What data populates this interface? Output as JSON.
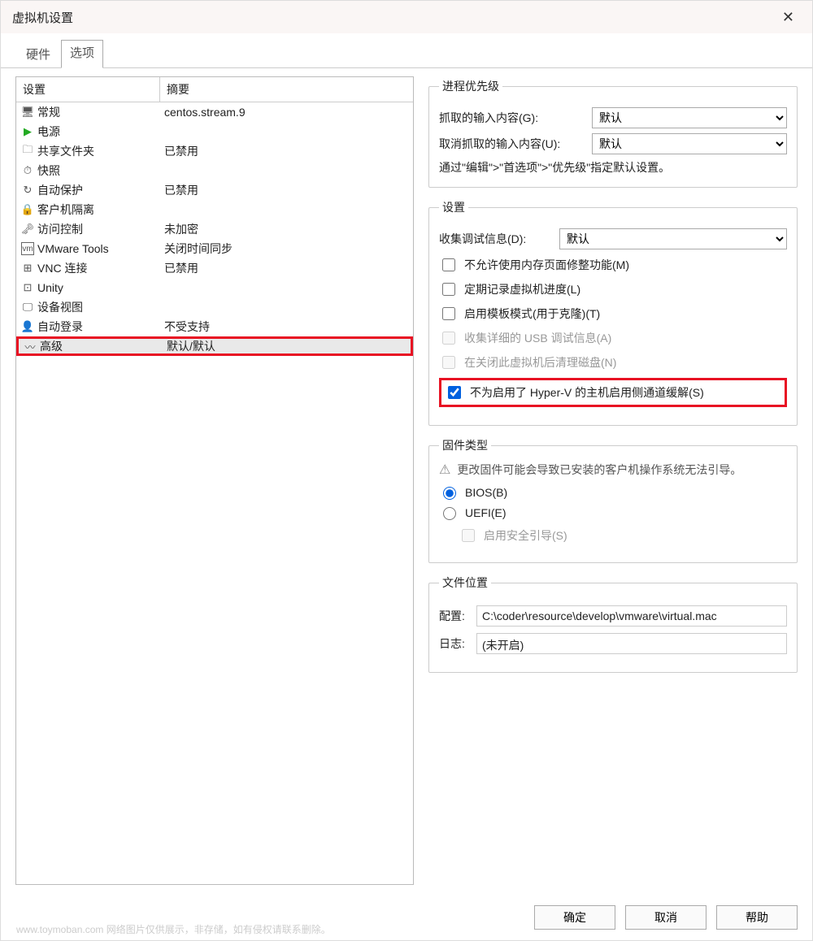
{
  "window": {
    "title": "虚拟机设置"
  },
  "tabs": {
    "hardware": "硬件",
    "options": "选项"
  },
  "list": {
    "header": {
      "setting": "设置",
      "summary": "摘要"
    },
    "rows": [
      {
        "icon": "monitor-icon",
        "name": "常规",
        "summary": "centos.stream.9"
      },
      {
        "icon": "play-icon",
        "name": "电源",
        "summary": ""
      },
      {
        "icon": "folder-share-icon",
        "name": "共享文件夹",
        "summary": "已禁用"
      },
      {
        "icon": "snapshot-icon",
        "name": "快照",
        "summary": ""
      },
      {
        "icon": "clock-icon",
        "name": "自动保护",
        "summary": "已禁用"
      },
      {
        "icon": "lock-icon",
        "name": "客户机隔离",
        "summary": ""
      },
      {
        "icon": "key-icon",
        "name": "访问控制",
        "summary": "未加密"
      },
      {
        "icon": "vm-icon",
        "name": "VMware Tools",
        "summary": "关闭时间同步"
      },
      {
        "icon": "vnc-icon",
        "name": "VNC 连接",
        "summary": "已禁用"
      },
      {
        "icon": "unity-icon",
        "name": "Unity",
        "summary": ""
      },
      {
        "icon": "display-icon",
        "name": "设备视图",
        "summary": ""
      },
      {
        "icon": "user-icon",
        "name": "自动登录",
        "summary": "不受支持"
      },
      {
        "icon": "advanced-icon",
        "name": "高级",
        "summary": "默认/默认"
      }
    ]
  },
  "priority": {
    "legend": "进程优先级",
    "grabbed_label": "抓取的输入内容(G):",
    "ungrabbed_label": "取消抓取的输入内容(U):",
    "option_default": "默认",
    "hint": "通过\"编辑\">\"首选项\">\"优先级\"指定默认设置。"
  },
  "settings": {
    "legend": "设置",
    "debug_label": "收集调试信息(D):",
    "debug_option": "默认",
    "chk_mem": "不允许使用内存页面修整功能(M)",
    "chk_log": "定期记录虚拟机进度(L)",
    "chk_template": "启用模板模式(用于克隆)(T)",
    "chk_usb": "收集详细的 USB 调试信息(A)",
    "chk_clean": "在关闭此虚拟机后清理磁盘(N)",
    "chk_hyperv": "不为启用了 Hyper-V 的主机启用侧通道缓解(S)"
  },
  "firmware": {
    "legend": "固件类型",
    "warning": "更改固件可能会导致已安装的客户机操作系统无法引导。",
    "bios": "BIOS(B)",
    "uefi": "UEFI(E)",
    "secureboot": "启用安全引导(S)"
  },
  "filelocation": {
    "legend": "文件位置",
    "config_label": "配置:",
    "config_value": "C:\\coder\\resource\\develop\\vmware\\virtual.mac",
    "log_label": "日志:",
    "log_value": "(未开启)"
  },
  "buttons": {
    "ok": "确定",
    "cancel": "取消",
    "help": "帮助"
  },
  "watermark": "www.toymoban.com 网络图片仅供展示，非存储，如有侵权请联系删除。"
}
